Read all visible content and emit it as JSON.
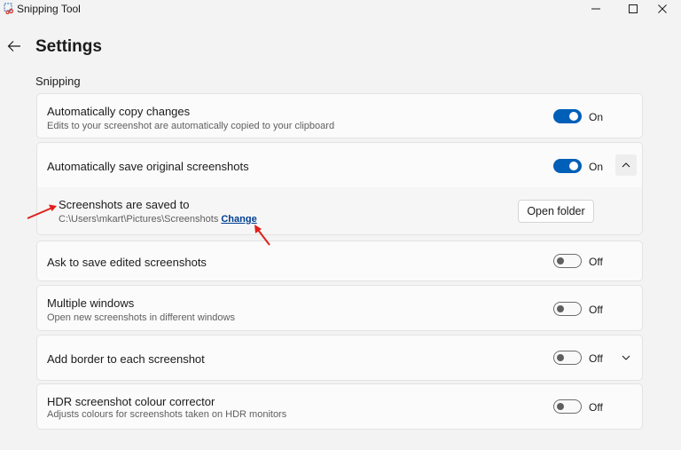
{
  "app": {
    "title": "Snipping Tool"
  },
  "page": {
    "title": "Settings",
    "section": "Snipping"
  },
  "settings": {
    "copy": {
      "label": "Automatically copy changes",
      "desc": "Edits to your screenshot are automatically copied to your clipboard",
      "state": "On",
      "on": true
    },
    "save": {
      "label": "Automatically save original screenshots",
      "state": "On",
      "on": true
    },
    "saved_to": {
      "label": "Screenshots are saved to",
      "path": "C:\\Users\\mkart\\Pictures\\Screenshots",
      "change": "Change",
      "open_folder": "Open folder"
    },
    "ask": {
      "label": "Ask to save edited screenshots",
      "state": "Off",
      "on": false
    },
    "multi": {
      "label": "Multiple windows",
      "desc": "Open new screenshots in different windows",
      "state": "Off",
      "on": false
    },
    "border": {
      "label": "Add border to each screenshot",
      "state": "Off",
      "on": false
    },
    "hdr": {
      "label": "HDR screenshot colour corrector",
      "desc": "Adjusts colours for screenshots taken on HDR monitors",
      "state": "Off",
      "on": false
    }
  },
  "colors": {
    "accent": "#005fb8",
    "link": "#003e92",
    "annotation": "#e0201b"
  },
  "icons": [
    "app-icon",
    "minimize-icon",
    "maximize-icon",
    "close-icon",
    "back-arrow-icon",
    "chevron-up-icon",
    "chevron-down-icon"
  ]
}
